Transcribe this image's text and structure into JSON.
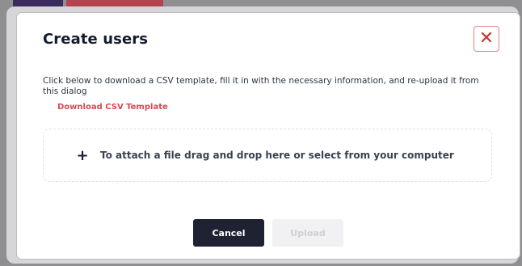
{
  "dialog": {
    "title": "Create users",
    "close_icon": "close-icon",
    "close_glyph": "✕",
    "description": "Click below to download a CSV template, fill it in with the necessary information, and re-upload it from this dialog",
    "download_link": "Download CSV Template",
    "dropzone": {
      "plus_glyph": "+",
      "text": "To attach a file drag and drop here or select from your computer"
    },
    "buttons": {
      "cancel": "Cancel",
      "upload": "Upload"
    }
  },
  "colors": {
    "accent": "#d64a55",
    "primary_button": "#1e2233",
    "disabled_button": "#f1f1f3"
  }
}
